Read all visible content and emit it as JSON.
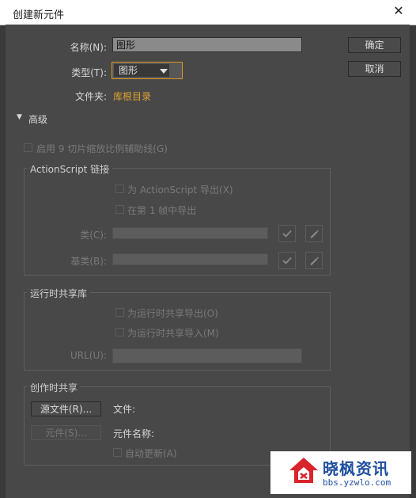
{
  "window": {
    "title": "创建新元件",
    "close_glyph": "✕"
  },
  "form": {
    "name_label": "名称(N):",
    "name_value": "图形",
    "type_label": "类型(T):",
    "type_value": "图形",
    "folder_label": "文件夹:",
    "folder_link": "库根目录"
  },
  "buttons": {
    "ok": "确定",
    "cancel": "取消"
  },
  "advanced": {
    "toggle_label": "高级",
    "toggle_glyph": "▼"
  },
  "nine_slice": {
    "label": "启用 9 切片缩放比例辅助线(G)"
  },
  "actionscript": {
    "group_label": "ActionScript 链接",
    "export_for_as": "为 ActionScript 导出(X)",
    "export_frame1": "在第 1 帧中导出",
    "class_label": "类(C):",
    "base_class_label": "基类(B):"
  },
  "runtime_shared": {
    "group_label": "运行时共享库",
    "export_runtime": "为运行时共享导出(O)",
    "import_runtime": "为运行时共享导入(M)",
    "url_label": "URL(U):"
  },
  "authortime_shared": {
    "group_label": "创作时共享",
    "source_file_button": "源文件(R)...",
    "file_label": "文件:",
    "symbol_button": "元件(S)...",
    "symbol_name_label": "元件名称:",
    "auto_update": "自动更新(A)"
  },
  "watermark": {
    "brand": "晓枫资讯",
    "url": "bbs.yzwlo.com"
  },
  "colors": {
    "accent": "#e0a334",
    "background": "#484848",
    "watermark_red": "#d9242b",
    "watermark_blue": "#1f4fa0"
  },
  "icons": [
    "checkmark-icon",
    "pencil-icon",
    "house-logo-icon"
  ]
}
